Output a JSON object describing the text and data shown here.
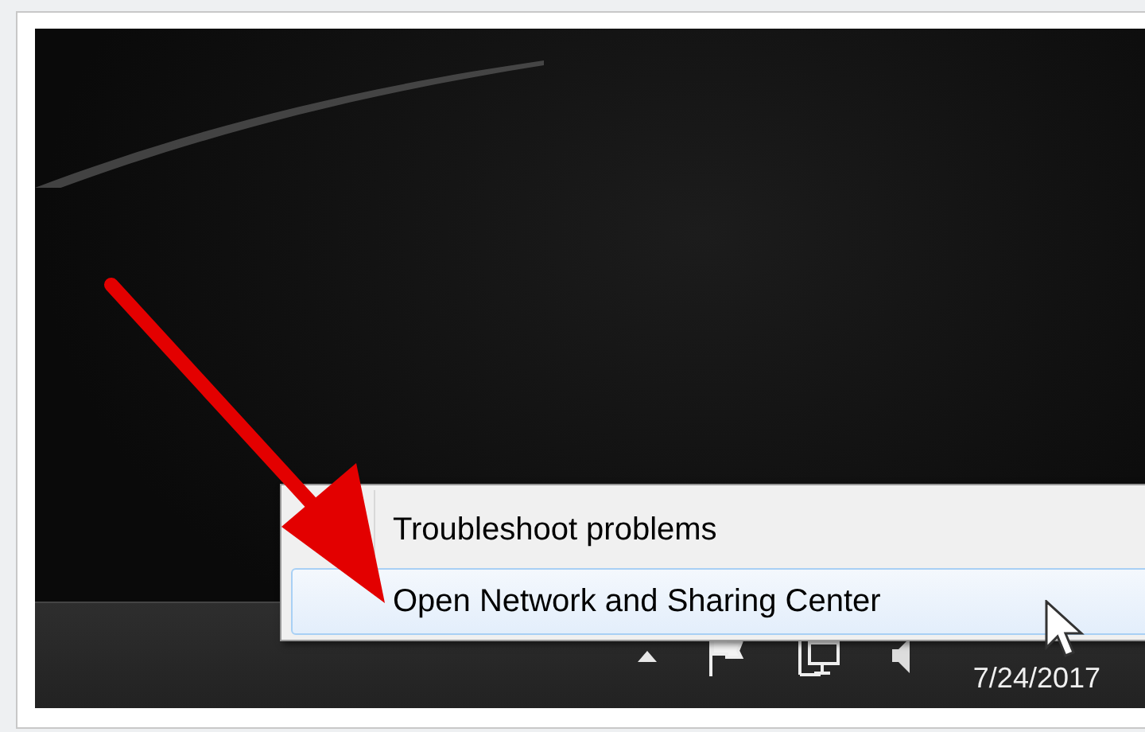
{
  "context_menu": {
    "items": [
      {
        "label": "Troubleshoot problems",
        "selected": false
      },
      {
        "label": "Open Network and Sharing Center",
        "selected": true
      }
    ]
  },
  "taskbar": {
    "date": "7/24/2017"
  }
}
